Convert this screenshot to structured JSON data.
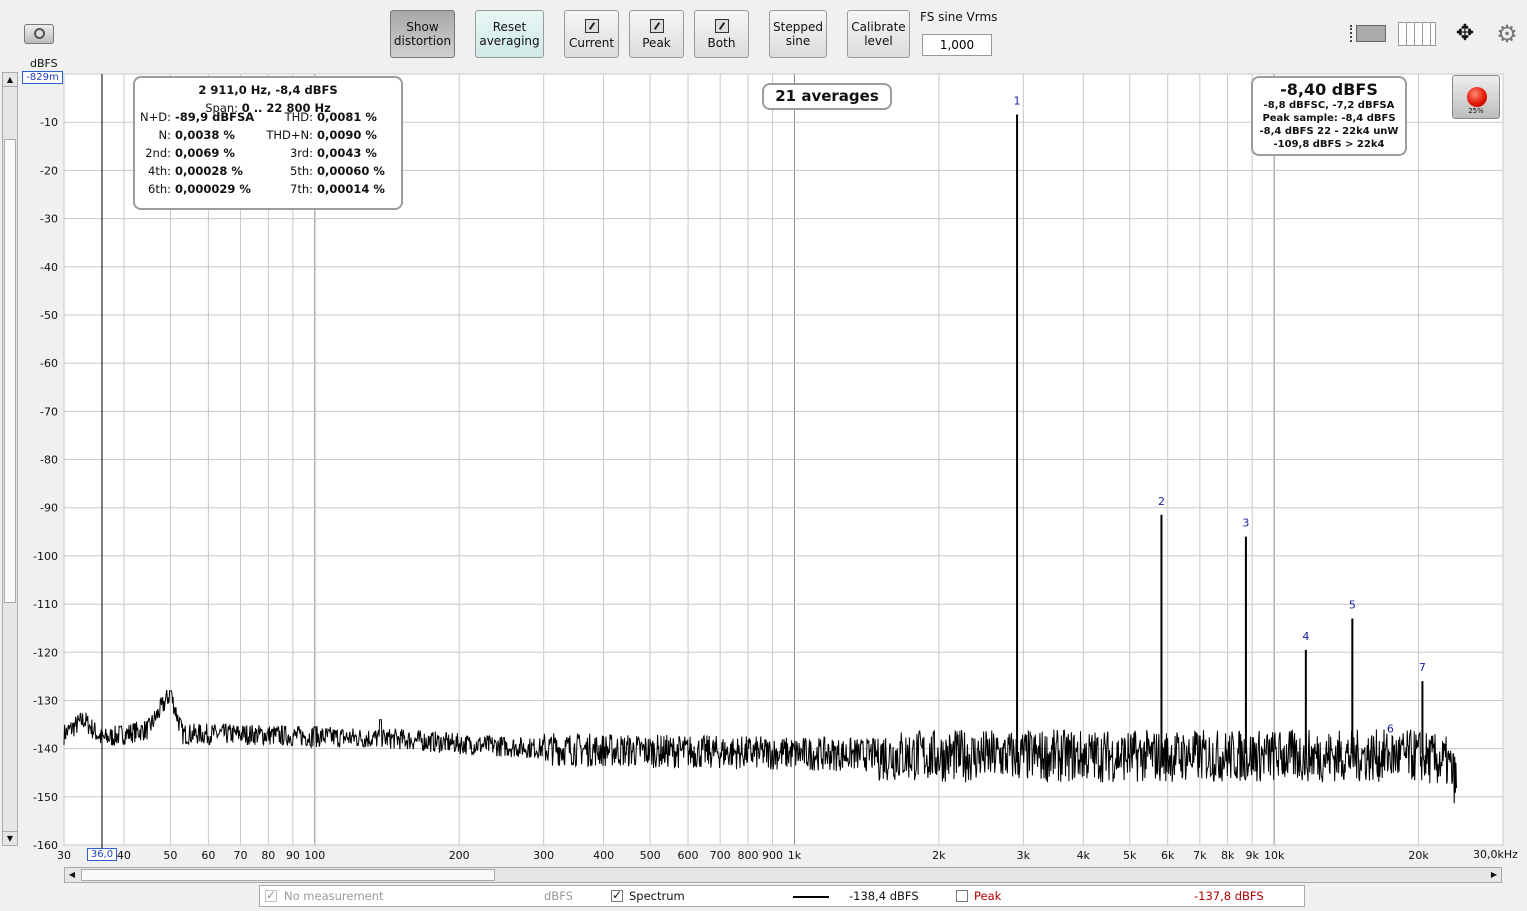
{
  "toolbar": {
    "show_distortion": "Show\ndistortion",
    "reset_averaging": "Reset\naveraging",
    "current": "Current",
    "peak": "Peak",
    "both": "Both",
    "stepped_sine": "Stepped\nsine",
    "calibrate_level": "Calibrate\nlevel",
    "fs_sine_label": "FS sine Vrms",
    "fs_sine_value": "1,000"
  },
  "axis": {
    "y_unit": "dBFS",
    "y_offset_readout": "-829m",
    "x_cursor_readout": "36,0",
    "x_unit_label": "30,0kHz"
  },
  "distortion_panel": {
    "header": "2 911,0 Hz, -8,4 dBFS",
    "span_label": "Span:",
    "span_value": "0 .. 22 800 Hz",
    "rows": [
      {
        "l1": "N+D:",
        "v1": "-89,9 dBFSA",
        "l2": "THD:",
        "v2": "0,0081 %"
      },
      {
        "l1": "N:",
        "v1": "0,0038 %",
        "l2": "THD+N:",
        "v2": "0,0090 %"
      },
      {
        "l1": "2nd:",
        "v1": "0,0069 %",
        "l2": "3rd:",
        "v2": "0,0043 %"
      },
      {
        "l1": "4th:",
        "v1": "0,00028 %",
        "l2": "5th:",
        "v2": "0,00060 %"
      },
      {
        "l1": "6th:",
        "v1": "0,000029 %",
        "l2": "7th:",
        "v2": "0,00014 %"
      }
    ]
  },
  "averages_label": "21 averages",
  "level_panel": {
    "main": "-8,40 dBFS",
    "line1": "-8,8 dBFSC, -7,2 dBFSA",
    "line2": "Peak sample: -8,4 dBFS",
    "line3": "-8,4 dBFS 22 - 22k4 unW",
    "line4": "-109,8 dBFS > 22k4"
  },
  "record_button_label": "25%",
  "legend": {
    "no_measurement": "No measurement",
    "no_measurement_unit": "dBFS",
    "spectrum": "Spectrum",
    "spectrum_value": "-138,4 dBFS",
    "peak": "Peak",
    "peak_value": "-137,8 dBFS"
  },
  "colors": {
    "trace": "#000000",
    "harmonic_label": "#1a1aa6",
    "peak_text": "#b00000",
    "grid": "#c8c8c8",
    "plot_bg": "#ffffff"
  },
  "chart_data": {
    "type": "line",
    "x_scale": "log",
    "xlim": [
      30,
      30000
    ],
    "ylim": [
      -160,
      0
    ],
    "ylabel": "dBFS",
    "x_ticks": [
      {
        "v": 30,
        "label": "30"
      },
      {
        "v": 40,
        "label": "40"
      },
      {
        "v": 50,
        "label": "50"
      },
      {
        "v": 60,
        "label": "60"
      },
      {
        "v": 70,
        "label": "70"
      },
      {
        "v": 80,
        "label": "80"
      },
      {
        "v": 90,
        "label": "90"
      },
      {
        "v": 100,
        "label": "100"
      },
      {
        "v": 200,
        "label": "200"
      },
      {
        "v": 300,
        "label": "300"
      },
      {
        "v": 400,
        "label": "400"
      },
      {
        "v": 500,
        "label": "500"
      },
      {
        "v": 600,
        "label": "600"
      },
      {
        "v": 700,
        "label": "700"
      },
      {
        "v": 800,
        "label": "800"
      },
      {
        "v": 900,
        "label": "900"
      },
      {
        "v": 1000,
        "label": "1k"
      },
      {
        "v": 2000,
        "label": "2k"
      },
      {
        "v": 3000,
        "label": "3k"
      },
      {
        "v": 4000,
        "label": "4k"
      },
      {
        "v": 5000,
        "label": "5k"
      },
      {
        "v": 6000,
        "label": "6k"
      },
      {
        "v": 7000,
        "label": "7k"
      },
      {
        "v": 8000,
        "label": "8k"
      },
      {
        "v": 9000,
        "label": "9k"
      },
      {
        "v": 10000,
        "label": "10k"
      },
      {
        "v": 20000,
        "label": "20k"
      }
    ],
    "y_ticks": [
      {
        "v": -10,
        "label": "-10"
      },
      {
        "v": -20,
        "label": "-20"
      },
      {
        "v": -30,
        "label": "-30"
      },
      {
        "v": -40,
        "label": "-40"
      },
      {
        "v": -50,
        "label": "-50"
      },
      {
        "v": -60,
        "label": "-60"
      },
      {
        "v": -70,
        "label": "-70"
      },
      {
        "v": -80,
        "label": "-80"
      },
      {
        "v": -90,
        "label": "-90"
      },
      {
        "v": -100,
        "label": "-100"
      },
      {
        "v": -110,
        "label": "-110"
      },
      {
        "v": -120,
        "label": "-120"
      },
      {
        "v": -130,
        "label": "-130"
      },
      {
        "v": -140,
        "label": "-140"
      },
      {
        "v": -150,
        "label": "-150"
      },
      {
        "v": -160,
        "label": "-160"
      }
    ],
    "cursor_x": 36,
    "noise_floor": [
      [
        30,
        -137
      ],
      [
        33,
        -134
      ],
      [
        36,
        -138
      ],
      [
        40,
        -137
      ],
      [
        45,
        -136
      ],
      [
        50,
        -128.5
      ],
      [
        53,
        -137
      ],
      [
        60,
        -137
      ],
      [
        70,
        -137
      ],
      [
        100,
        -137.5
      ],
      [
        150,
        -138
      ],
      [
        200,
        -139
      ],
      [
        300,
        -140
      ],
      [
        500,
        -140.5
      ],
      [
        1000,
        -141
      ],
      [
        2000,
        -141.5
      ],
      [
        5000,
        -141.5
      ],
      [
        10000,
        -141.5
      ],
      [
        20000,
        -141.5
      ],
      [
        23000,
        -143
      ],
      [
        24000,
        -147
      ]
    ],
    "spurs": [
      {
        "x": 50,
        "y": -128
      },
      {
        "x": 100,
        "y": -135.5
      },
      {
        "x": 137,
        "y": -134
      }
    ],
    "harmonics": [
      {
        "n": "1",
        "x": 2911,
        "y": -8.4
      },
      {
        "n": "2",
        "x": 5822,
        "y": -91.5
      },
      {
        "n": "3",
        "x": 8733,
        "y": -96
      },
      {
        "n": "4",
        "x": 11644,
        "y": -119.5
      },
      {
        "n": "5",
        "x": 14555,
        "y": -113
      },
      {
        "n": "6",
        "x": 17466,
        "y": -140
      },
      {
        "n": "7",
        "x": 20377,
        "y": -126
      }
    ]
  }
}
